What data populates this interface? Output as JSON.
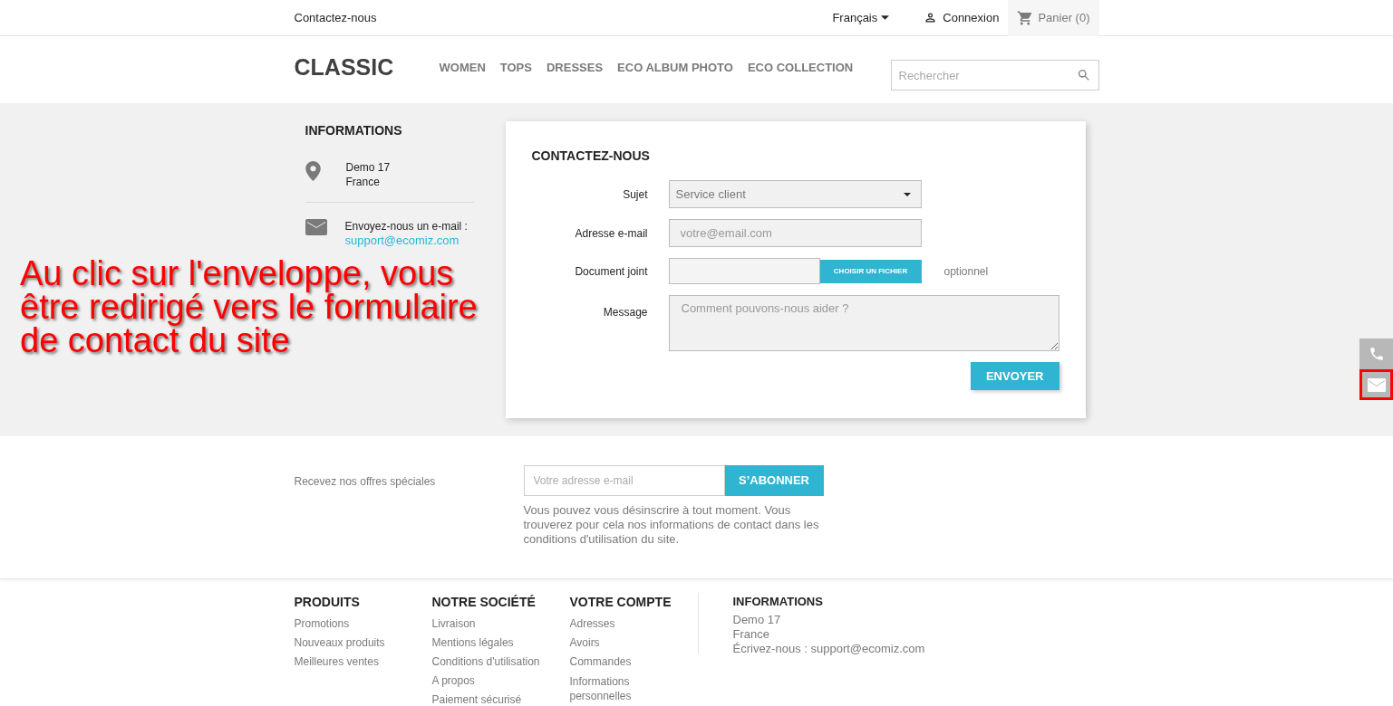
{
  "top_bar": {
    "contact_link": "Contactez-nous",
    "language": "Français",
    "login": "Connexion",
    "cart": "Panier (0)"
  },
  "header": {
    "logo": "CLASSIC",
    "nav": [
      "WOMEN",
      "TOPS",
      "DRESSES",
      "ECO ALBUM PHOTO",
      "ECO COLLECTION"
    ],
    "search_placeholder": "Rechercher"
  },
  "info": {
    "title": "INFORMATIONS",
    "address": [
      "Demo 17",
      "France"
    ],
    "email_label": "Envoyez-nous un e-mail :",
    "email": "support@ecomiz.com"
  },
  "contact_form": {
    "title": "CONTACTEZ-NOUS",
    "fields": [
      {
        "kind": "select",
        "label": "Sujet",
        "value": "Service client"
      },
      {
        "kind": "text",
        "label": "Adresse e-mail",
        "placeholder": "votre@email.com"
      },
      {
        "kind": "file",
        "label": "Document joint",
        "button": "CHOISIR UN FICHIER",
        "hint": "optionnel"
      },
      {
        "kind": "textarea",
        "label": "Message",
        "placeholder": "Comment pouvons-nous aider ?"
      }
    ],
    "submit": "ENVOYER"
  },
  "annotation": "Au clic sur l'enveloppe, vous être redirigé vers le formulaire de contact du site",
  "side_widget": [
    {
      "kind": "phone",
      "highlighted": false
    },
    {
      "kind": "mail",
      "highlighted": true
    }
  ],
  "newsletter": {
    "label": "Recevez nos offres spéciales",
    "placeholder": "Votre adresse e-mail",
    "button": "S’ABONNER",
    "note": "Vous pouvez vous désinscrire à tout moment. Vous trouverez pour cela nos informations de contact dans les conditions d'utilisation du site."
  },
  "footer": {
    "columns": [
      {
        "title": "PRODUITS",
        "links": [
          "Promotions",
          "Nouveaux produits",
          "Meilleures ventes"
        ]
      },
      {
        "title": "NOTRE SOCIÉTÉ",
        "links": [
          "Livraison",
          "Mentions légales",
          "Conditions d'utilisation",
          "A propos",
          "Paiement sécurisé"
        ]
      },
      {
        "title": "VOTRE COMPTE",
        "links": [
          "Adresses",
          "Avoirs",
          "Commandes",
          "Informations personnelles"
        ]
      }
    ],
    "info": {
      "title": "INFORMATIONS",
      "lines": [
        "Demo 17",
        "France",
        "Écrivez-nous : support@ecomiz.com"
      ]
    }
  }
}
